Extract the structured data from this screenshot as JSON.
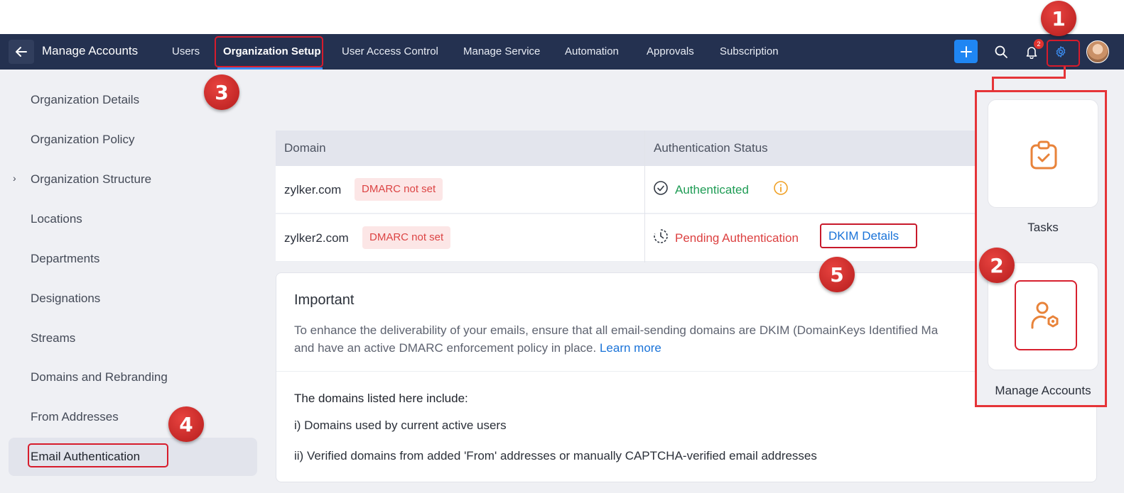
{
  "header": {
    "back_icon": "arrow-left-icon",
    "title": "Manage Accounts",
    "tabs": [
      {
        "label": "Users"
      },
      {
        "label": "Organization Setup",
        "active": true
      },
      {
        "label": "User Access Control"
      },
      {
        "label": "Manage Service"
      },
      {
        "label": "Automation"
      },
      {
        "label": "Approvals"
      },
      {
        "label": "Subscription"
      }
    ],
    "notification_count": "2",
    "icons": [
      "plus-icon",
      "search-icon",
      "bell-icon",
      "gear-icon",
      "avatar"
    ]
  },
  "sidebar": {
    "items": [
      {
        "label": "Organization Details"
      },
      {
        "label": "Organization Policy"
      },
      {
        "label": "Organization Structure",
        "expandable": true
      },
      {
        "label": "Locations"
      },
      {
        "label": "Departments"
      },
      {
        "label": "Designations"
      },
      {
        "label": "Streams"
      },
      {
        "label": "Domains and Rebranding"
      },
      {
        "label": "From Addresses"
      },
      {
        "label": "Email Authentication",
        "active": true
      }
    ]
  },
  "table": {
    "columns": [
      "Domain",
      "Authentication Status"
    ],
    "rows": [
      {
        "domain": "zylker.com",
        "tag": "DMARC not set",
        "status": "Authenticated",
        "status_color": "#1f9c55"
      },
      {
        "domain": "zylker2.com",
        "tag": "DMARC not set",
        "status": "Pending Authentication",
        "status_color": "#dc4040",
        "action": "DKIM Details"
      }
    ]
  },
  "important": {
    "title": "Important",
    "text": "To enhance the deliverability of your emails, ensure that all email-sending domains are DKIM (DomainKeys Identified Ma",
    "text2": "and have an active DMARC enforcement policy in place. ",
    "learn_more": "Learn more",
    "list_heading": "The domains listed here include:",
    "list_items": [
      "i) Domains used by current active users",
      "ii) Verified domains from added 'From' addresses or manually CAPTCHA-verified email addresses"
    ]
  },
  "apps_panel": {
    "items": [
      {
        "label": "Tasks",
        "icon": "clipboard-check-icon"
      },
      {
        "label": "Manage Accounts",
        "icon": "user-gear-icon"
      }
    ]
  },
  "callouts": [
    "1",
    "2",
    "3",
    "4",
    "5"
  ],
  "colors": {
    "nav_bg": "#243150",
    "accent_blue": "#1f86f3",
    "highlight_red": "#d71c2c",
    "icon_orange": "#e8833a"
  }
}
